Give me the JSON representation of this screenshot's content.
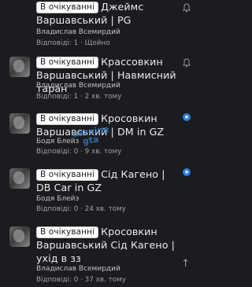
{
  "threads": [
    {
      "badge": "В очікуванні",
      "title": "Джеймс Варшавський | PG",
      "author": "Владислав Всемирдий",
      "meta": "Відповіді: 1 · Щойно",
      "icon": "bell-icon"
    },
    {
      "badge": "В очікуванні",
      "title": "Крассовкин Варшавський | Навмисний таран",
      "author": "Владислав Всемирдий",
      "meta": "Відповіді: 1 · 2 хв. тому",
      "icon": "bell-icon"
    },
    {
      "badge": "В очікуванні",
      "title": "Кросовкин Варшавський | DM in GZ",
      "author": "Бодя Блейз",
      "meta": "Відповіді: 0 · 9 хв. тому",
      "icon": "pin-icon"
    },
    {
      "badge": "В очікуванні",
      "title": "Сід Кагено | DB Car in GZ",
      "author": "Бодя Блейз",
      "meta": "Відповіді: 0 · 24 хв. тому",
      "icon": "pin-icon"
    },
    {
      "badge": "В очікуванні",
      "title": "Кросовкин Варшавський Сід Кагено | ухід в зз",
      "author": "Владислав Всемирдий",
      "meta": "Відповіді: 0 · 37 хв. тому",
      "icon": "arrow-up-icon"
    }
  ],
  "watermark": "ukraine gta"
}
